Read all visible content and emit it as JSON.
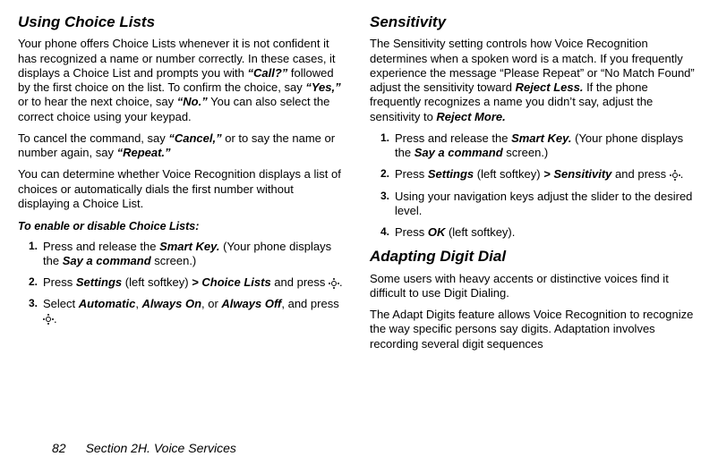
{
  "left": {
    "heading": "Using Choice Lists",
    "p1_a": "Your phone offers Choice Lists whenever it is not confident it has recognized a name or number correctly. In these cases, it displays a Choice List and prompts you with ",
    "p1_call": "“Call?”",
    "p1_b": " followed by the first choice on the list. To confirm the choice, say ",
    "p1_yes": "“Yes,”",
    "p1_c": " or to hear the next choice, say ",
    "p1_no": "“No.”",
    "p1_d": " You can also select the correct choice using your keypad.",
    "p2_a": "To cancel the command, say ",
    "p2_cancel": "“Cancel,”",
    "p2_b": " or to say the name or number again, say ",
    "p2_repeat": "“Repeat.”",
    "p3": "You can determine whether Voice Recognition displays a list of choices or automatically dials the first number without displaying a Choice List.",
    "action": "To enable or disable Choice Lists:",
    "li1_a": "Press and release the ",
    "li1_smartkey": "Smart Key.",
    "li1_b": " (Your phone displays the ",
    "li1_say": "Say a command",
    "li1_c": " screen.)",
    "li2_a": "Press ",
    "li2_settings": "Settings",
    "li2_b": " (left softkey) ",
    "li2_gt": ">",
    "li2_choice": "Choice Lists",
    "li2_c": " and press ",
    "li2_period": ".",
    "li3_a": "Select ",
    "li3_auto": "Automatic",
    "li3_com1": ", ",
    "li3_on": "Always On",
    "li3_com2": ", or ",
    "li3_off": "Always Off",
    "li3_b": ", and press ",
    "li3_period": "."
  },
  "right": {
    "heading": "Sensitivity",
    "p1_a": "The Sensitivity setting controls how Voice Recognition determines when a spoken word is a match. If you frequently experience the message “Please Repeat” or “No Match Found” adjust the sensitivity toward ",
    "p1_rejless": "Reject Less.",
    "p1_b": " If the phone frequently recognizes a name you didn’t say, adjust the sensitivity to ",
    "p1_rejmore": "Reject More.",
    "li1_a": "Press and release the ",
    "li1_smartkey": "Smart Key.",
    "li1_b": " (Your phone displays the ",
    "li1_say": "Say a command",
    "li1_c": " screen.)",
    "li2_a": "Press ",
    "li2_settings": "Settings",
    "li2_b": " (left softkey) ",
    "li2_gt": ">",
    "li2_sens": "Sensitivity",
    "li2_c": " and press ",
    "li2_period": ".",
    "li3": "Using your navigation keys adjust the slider to the desired level.",
    "li4_a": "Press ",
    "li4_ok": "OK",
    "li4_b": " (left softkey).",
    "heading2": "Adapting Digit Dial",
    "p2": "Some users with heavy accents or distinctive voices find it difficult to use Digit Dialing.",
    "p3": "The Adapt Digits feature allows Voice Recognition to recognize the way specific persons say digits. Adaptation involves recording several digit sequences"
  },
  "footer": {
    "page": "82",
    "section": "Section 2H. Voice Services"
  },
  "nums": {
    "n1": "1.",
    "n2": "2.",
    "n3": "3.",
    "n4": "4."
  }
}
